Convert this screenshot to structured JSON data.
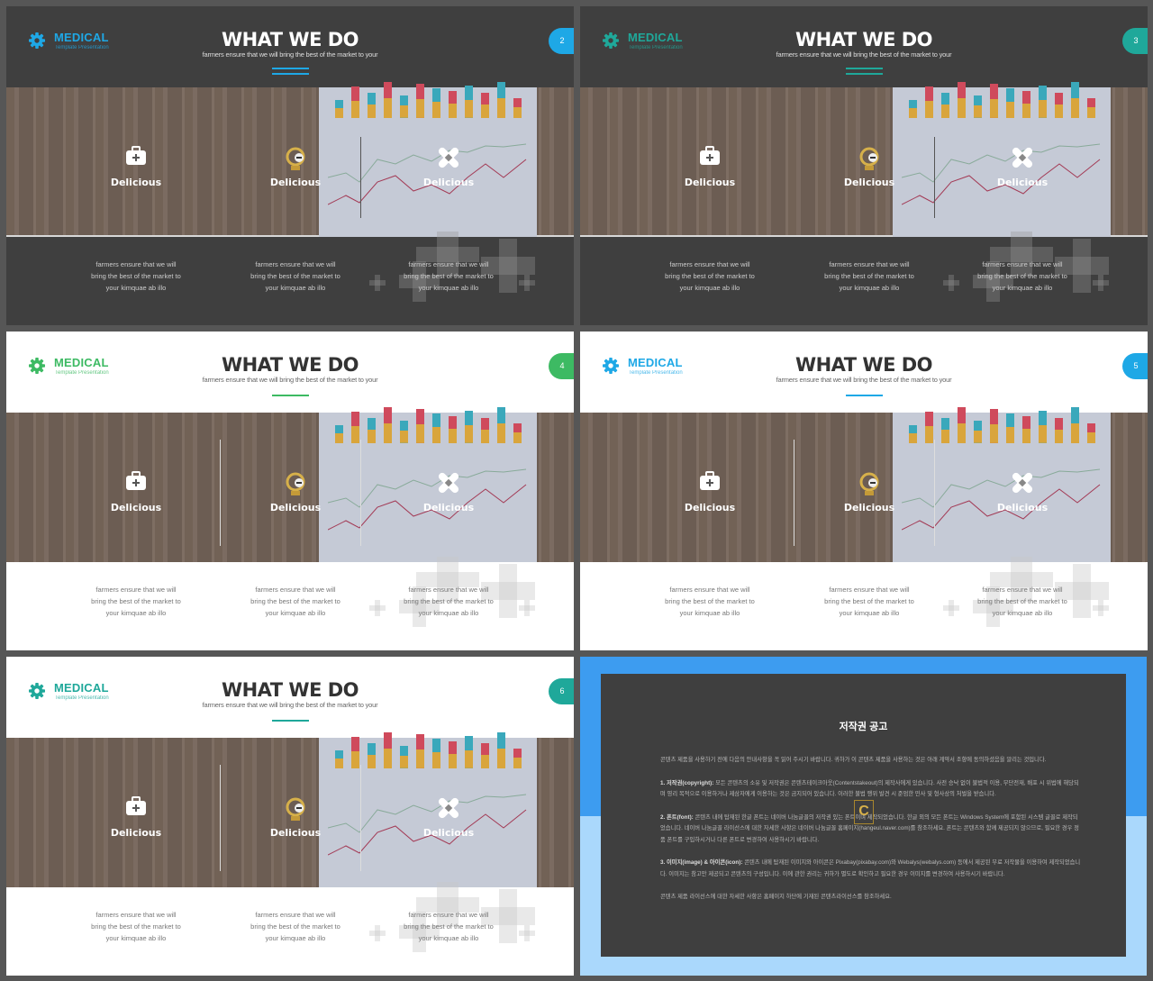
{
  "slides": [
    {
      "number": "2",
      "theme": "dark",
      "accent": "#1ea8e6"
    },
    {
      "number": "3",
      "theme": "dark",
      "accent": "#1fa89a"
    },
    {
      "number": "4",
      "theme": "light",
      "accent": "#3dba63"
    },
    {
      "number": "5",
      "theme": "light",
      "accent": "#1ea8e6"
    },
    {
      "number": "6",
      "theme": "light",
      "accent": "#1fa89a"
    }
  ],
  "common": {
    "brand": "MEDICAL",
    "brand_sub": "Template Presentation",
    "title": "WHAT WE DO",
    "subtitle": "farmers ensure that we will bring the best of the market to your",
    "items": [
      {
        "icon": "first-aid-kit-icon",
        "label": "Delicious",
        "desc": [
          "farmers ensure that we will",
          "bring the best of the market to",
          "your kimquae ab illo"
        ]
      },
      {
        "icon": "contents-logo-icon",
        "label": "Delicious",
        "desc": [
          "farmers ensure that we will",
          "bring the best of the market to",
          "your kimquae ab illo"
        ]
      },
      {
        "icon": "bandage-icon",
        "label": "Delicious",
        "desc": [
          "farmers ensure that we will",
          "bring the best of the market to",
          "your kimquae ab illo"
        ]
      }
    ]
  },
  "copyright": {
    "title": "저작권 공고",
    "intro": "콘텐츠 제품을 사용하기 전에 다음의 안내사항을 꼭 읽어 주시기 바랍니다. 귀하가 이 콘텐츠 제품을 사용하는 것은 아래 계약서 조항에 동의하셨음을 알리는 것입니다.",
    "sections": [
      {
        "head": "1. 저작권(copyright):",
        "text": "모든 콘텐츠의 소유 및 저작권은 콘텐츠테이크아웃(Contentstakeout)의 제작사에게 있습니다. 사전 승낙 없이 불법적 이용, 무단전재, 배포 시 위법에 해당되며 영리 목적으로 이용하거나 제삼자에게 이용하는 것은 금지되어 있습니다. 이러한 불법 행위 발견 시 준엄한 민사 및 형사상의 처벌을 받습니다."
      },
      {
        "head": "2. 폰트(font):",
        "text": "콘텐츠 내에 탑재된 한글 폰트는 네이버 나눔글꼴의 저작권 있는 폰트이며 제작되었습니다. 한글 외의 모든 폰트는 Windows System에 포함된 시스템 글꼴로 제작되었습니다. 네이버 나눔글꼴 라이선스에 대한 자세한 사항은 네이버 나눔글꼴 홈페이지(hangeul.naver.com)를 참조하세요. 폰트는 콘텐츠와 함께 제공되지 않으므로, 필요한 경우 정품 폰트를 구입하시거나 다른 폰트로 변경하여 사용하시기 바랍니다."
      },
      {
        "head": "3. 이미지(image) & 아이콘(icon):",
        "text": "콘텐츠 내에 탑재된 이미지와 아이콘은 Pixabay(pixabay.com)와 Webalys(webalys.com) 등에서 제공된 무료 저작물을 이용하여 제작되었습니다. 이미지는 참고만 제공되고 콘텐츠의 구성입니다. 이에 관한 권리는 귀하가 별도로 확인하고 필요한 경우 이미지를 변경하여 사용하시기 바랍니다."
      }
    ],
    "footer": "콘텐츠 제품 라이선스에 대한 자세한 사항은 홈페이지 하단에 기재된 콘텐츠라이선스를 참조하세요.",
    "logo": "C"
  }
}
